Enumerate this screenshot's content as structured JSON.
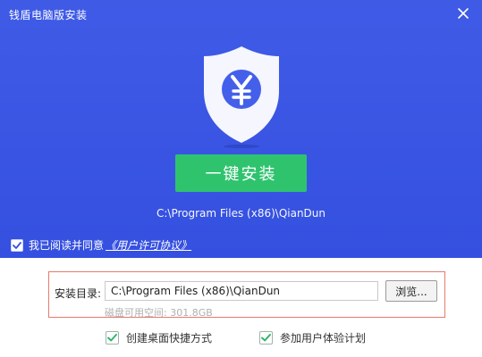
{
  "window": {
    "title": "钱盾电脑版安装",
    "close_icon": "close-icon"
  },
  "hero": {
    "logo_icon": "shield-yen-icon",
    "install_button": "一键安装",
    "install_path": "C:\\Program Files (x86)\\QianDun"
  },
  "agreement": {
    "checked": true,
    "text": "我已阅读并同意",
    "link": "《用户许可协议》"
  },
  "install_options": {
    "dir_label": "安装目录:",
    "dir_value": "C:\\Program Files (x86)\\QianDun",
    "browse_button": "浏览...",
    "disk_space": "磁盘可用空间: 301.8GB"
  },
  "checkboxes": [
    {
      "label": "创建桌面快捷方式",
      "checked": true
    },
    {
      "label": "参加用户体验计划",
      "checked": true
    }
  ],
  "colors": {
    "header_bg": "#3a55e3",
    "install_button": "#2fc36e",
    "highlight_border": "#e57a6f",
    "check_green": "#2fb36a"
  }
}
